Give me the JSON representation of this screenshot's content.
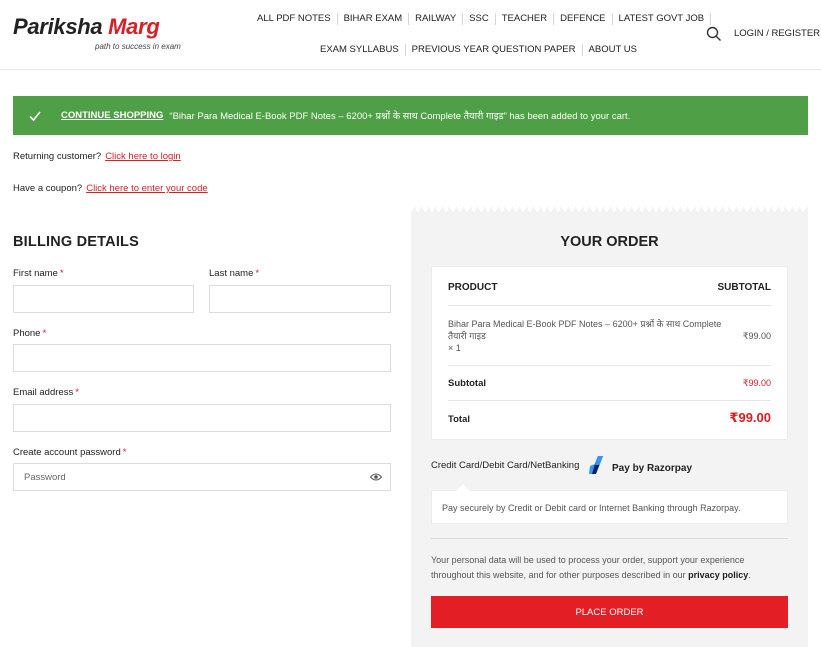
{
  "brand": {
    "name_part1": "Pariksha",
    "name_part2": "Marg",
    "tagline": "path to success in exam",
    "accent_color": "#d42027",
    "success_color": "#4f9f46",
    "button_color": "#e31e24"
  },
  "nav": {
    "row1": [
      "ALL PDF NOTES",
      "BIHAR EXAM",
      "RAILWAY",
      "SSC",
      "TEACHER",
      "DEFENCE",
      "LATEST GOVT JOB"
    ],
    "row2": [
      "EXAM SYLLABUS",
      "PREVIOUS YEAR QUESTION PAPER",
      "ABOUT US"
    ],
    "search_icon": "search-icon",
    "login_label": "LOGIN / REGISTER"
  },
  "notice": {
    "icon": "check-icon",
    "continue_label": "CONTINUE SHOPPING",
    "message": "“Bihar Para Medical E-Book PDF Notes – 6200+ प्रश्नों के साथ Complete तैयारी गाइड” has been added to your cart."
  },
  "returning": {
    "text": "Returning customer?",
    "link": "Click here to login"
  },
  "coupon": {
    "text": "Have a coupon?",
    "link": "Click here to enter your code"
  },
  "billing": {
    "title": "BILLING DETAILS",
    "first_name_label": "First name",
    "last_name_label": "Last name",
    "phone_label": "Phone",
    "email_label": "Email address",
    "password_label": "Create account password",
    "password_placeholder": "Password",
    "required_mark": "*"
  },
  "order": {
    "title": "YOUR ORDER",
    "product_header": "PRODUCT",
    "subtotal_header": "SUBTOTAL",
    "product_name": "Bihar Para Medical E-Book PDF Notes – 6200+ प्रश्नों के साथ Complete तैयारी गाइड",
    "product_qty": "× 1",
    "product_price": "₹99.00",
    "subtotal_label": "Subtotal",
    "subtotal_value": "₹99.00",
    "total_label": "Total",
    "total_value": "₹99.00"
  },
  "payment": {
    "method_label": "Credit Card/Debit Card/NetBanking",
    "provider_label": "Pay by Razorpay",
    "description": "Pay securely by Credit or Debit card or Internet Banking through Razorpay.",
    "privacy_text": "Your personal data will be used to process your order, support your experience throughout this website, and for other purposes described in our",
    "privacy_link": "privacy policy",
    "place_order_label": "PLACE ORDER"
  }
}
